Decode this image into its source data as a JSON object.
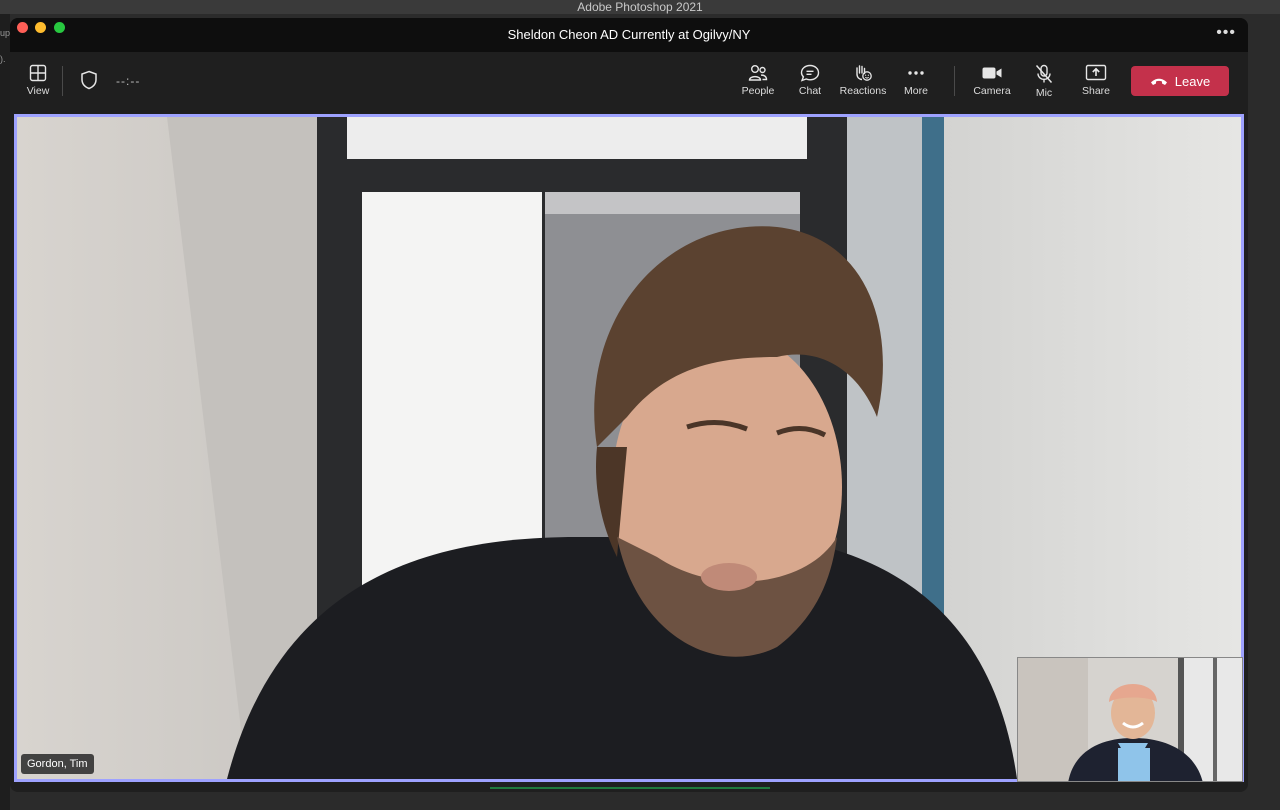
{
  "os": {
    "menubar_title": "Adobe Photoshop 2021",
    "left_fragment_1": "up",
    "left_fragment_2": ")."
  },
  "window": {
    "title": "Sheldon Cheon AD Currently at Ogilvy/NY",
    "more_glyph": "•••"
  },
  "toolbar": {
    "view_label": "View",
    "timer": "--:--",
    "people_label": "People",
    "chat_label": "Chat",
    "reactions_label": "Reactions",
    "more_label": "More",
    "camera_label": "Camera",
    "mic_label": "Mic",
    "share_label": "Share",
    "leave_label": "Leave"
  },
  "participant": {
    "name": "Gordon, Tim"
  },
  "colors": {
    "leave": "#c4314b",
    "active_border": "#9ea2ff",
    "toolbar_bg": "#1f1f1f"
  }
}
